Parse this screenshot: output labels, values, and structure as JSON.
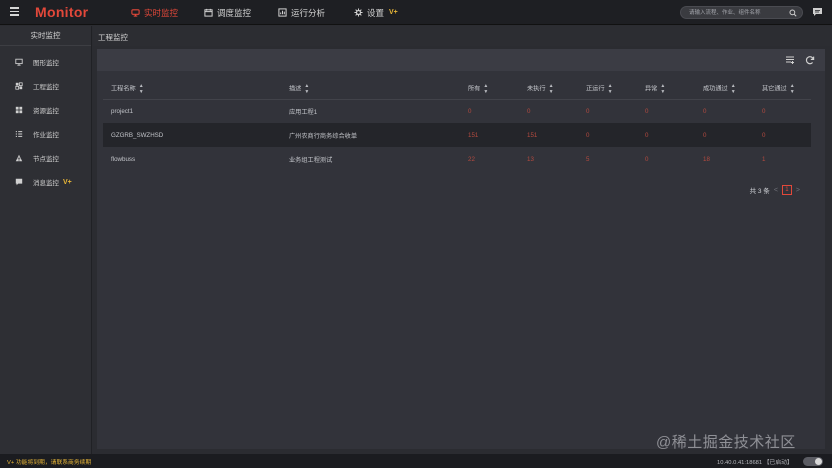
{
  "header": {
    "brand": "Monitor",
    "nav": [
      {
        "label": "实时监控",
        "icon": "realtime-icon",
        "active": true
      },
      {
        "label": "调度监控",
        "icon": "calendar-icon"
      },
      {
        "label": "运行分析",
        "icon": "chart-icon"
      },
      {
        "label": "设置",
        "icon": "gear-icon",
        "badge": "V+"
      }
    ],
    "search_placeholder": "请输入流程、作业、组件名称",
    "accent": "#e2483a",
    "vip_color": "#e8b637"
  },
  "sidebar": {
    "title": "实时监控",
    "items": [
      {
        "label": "图形监控",
        "icon": "monitor-icon"
      },
      {
        "label": "工程监控",
        "icon": "project-icon"
      },
      {
        "label": "资源监控",
        "icon": "resource-icon"
      },
      {
        "label": "作业监控",
        "icon": "list-icon"
      },
      {
        "label": "节点监控",
        "icon": "node-icon"
      },
      {
        "label": "消息监控",
        "icon": "message-icon",
        "badge": "V+"
      }
    ]
  },
  "breadcrumb": "工程监控",
  "table": {
    "columns": [
      "工程名称",
      "描述",
      "所有",
      "未执行",
      "正运行",
      "异常",
      "成功通过",
      "其它通过"
    ],
    "rows": [
      {
        "name": "project1",
        "desc": "应用工程1",
        "all": "0",
        "pending": "0",
        "running": "0",
        "error": "0",
        "success": "0",
        "other": "0"
      },
      {
        "name": "GZGRB_SWZHSD",
        "desc": "广州农商行商务综合收单",
        "all": "151",
        "pending": "151",
        "running": "0",
        "error": "0",
        "success": "0",
        "other": "0"
      },
      {
        "name": "flowbuss",
        "desc": "业务组工程测试",
        "all": "22",
        "pending": "13",
        "running": "5",
        "error": "0",
        "success": "18",
        "other": "1"
      }
    ]
  },
  "pagination": {
    "total_text": "共 3 条",
    "prev": "<",
    "current": "1",
    "next": ">"
  },
  "footer": {
    "tip": "V+ 功能将到期，请联系商务续期",
    "meta": "10.40.0.41:18681 【已启动】"
  },
  "watermark": "@稀土掘金技术社区"
}
